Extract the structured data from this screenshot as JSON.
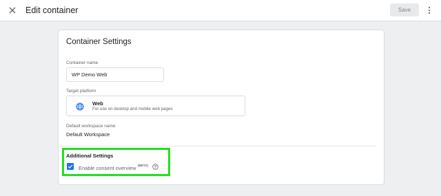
{
  "header": {
    "close_icon": "close-icon",
    "title": "Edit container",
    "save_label": "Save",
    "more_icon": "more-vert-icon"
  },
  "card": {
    "title": "Container Settings",
    "container_name": {
      "label": "Container name",
      "value": "WP Demo Web"
    },
    "target_platform": {
      "label": "Target platform",
      "icon": "globe-icon",
      "name": "Web",
      "description": "For use on desktop and mobile web pages"
    },
    "default_workspace": {
      "label": "Default workspace name",
      "value": "Default Workspace"
    },
    "additional_settings": {
      "title": "Additional Settings",
      "consent_overview": {
        "checked": true,
        "label": "Enable consent overview",
        "badge": "(BETA)",
        "help_icon": "help-circle-icon"
      }
    }
  },
  "colors": {
    "accent": "#1a73e8",
    "highlight": "#22e01e",
    "background": "#eeeff1"
  }
}
